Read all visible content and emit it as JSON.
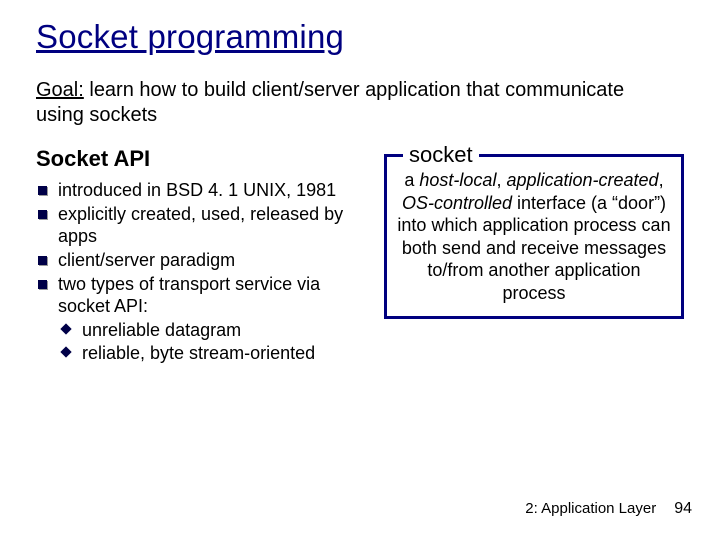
{
  "title": "Socket programming",
  "goal": {
    "label": "Goal:",
    "text": " learn how to build client/server application that communicate using sockets"
  },
  "left": {
    "heading": "Socket API",
    "items": [
      "introduced in BSD 4. 1 UNIX, 1981",
      "explicitly created, used, released by apps",
      "client/server paradigm",
      "two types of transport service via socket API:"
    ],
    "subitems": [
      "unreliable datagram",
      "reliable, byte stream-oriented"
    ]
  },
  "right": {
    "legend": "socket",
    "body_prefix": "a ",
    "em1": "host-local",
    "mid1": ", ",
    "em2": "application-created",
    "mid2": ", ",
    "em3": "OS-controlled",
    "body_suffix": " interface (a “door”) into which application process can both send and receive messages to/from another application process"
  },
  "footer": {
    "chapter": "2: Application Layer",
    "page": "94"
  }
}
